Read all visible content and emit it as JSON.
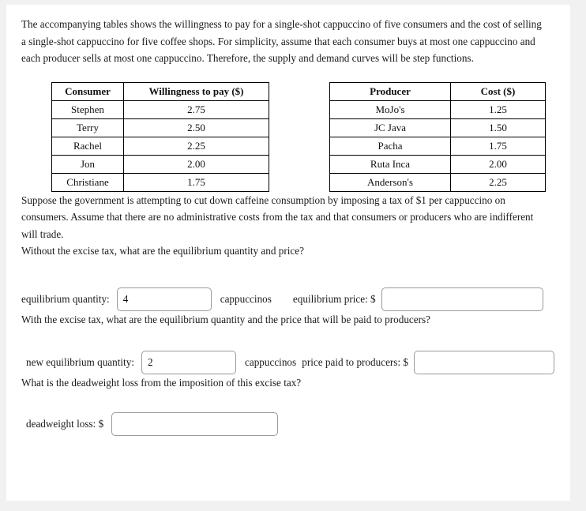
{
  "intro_paragraph": "The accompanying tables shows the willingness to pay for a single-shot cappuccino of five consumers and the cost of selling a single-shot cappuccino for five coffee shops. For simplicity, assume that each consumer buys at most one cappuccino and each producer sells at most one cappuccino. Therefore, the supply and demand curves will be step functions.",
  "consumer_table": {
    "headers": [
      "Consumer",
      "Willingness to pay ($)"
    ],
    "rows": [
      {
        "name": "Stephen",
        "value": "2.75"
      },
      {
        "name": "Terry",
        "value": "2.50"
      },
      {
        "name": "Rachel",
        "value": "2.25"
      },
      {
        "name": "Jon",
        "value": "2.00"
      },
      {
        "name": "Christiane",
        "value": "1.75"
      }
    ]
  },
  "producer_table": {
    "headers": [
      "Producer",
      "Cost ($)"
    ],
    "rows": [
      {
        "name": "MoJo's",
        "value": "1.25"
      },
      {
        "name": "JC Java",
        "value": "1.50"
      },
      {
        "name": "Pacha",
        "value": "1.75"
      },
      {
        "name": "Ruta Inca",
        "value": "2.00"
      },
      {
        "name": "Anderson's",
        "value": "2.25"
      }
    ]
  },
  "tax_paragraph": "Suppose the government is attempting to cut down caffeine consumption by imposing a tax of $1 per cappuccino on consumers. Assume that there are no administrative costs from the tax and that consumers or producers who are indifferent will trade.",
  "question_1": "Without the excise tax, what are the equilibrium quantity and price?",
  "answers_1": {
    "quantity_label": "equilibrium quantity:",
    "quantity_value": "4",
    "quantity_unit": "cappuccinos",
    "price_label": "equilibrium price: $",
    "price_value": ""
  },
  "question_2": "With the excise tax, what are the equilibrium quantity and the price that will be paid to producers?",
  "answers_2": {
    "quantity_label": "new equilibrium quantity:",
    "quantity_value": "2",
    "quantity_unit": "cappuccinos",
    "price_label": "price paid to producers: $",
    "price_value": ""
  },
  "question_3": "What is the deadweight loss from the imposition of this excise tax?",
  "answers_3": {
    "dwl_label": "deadweight loss: $",
    "dwl_value": ""
  }
}
